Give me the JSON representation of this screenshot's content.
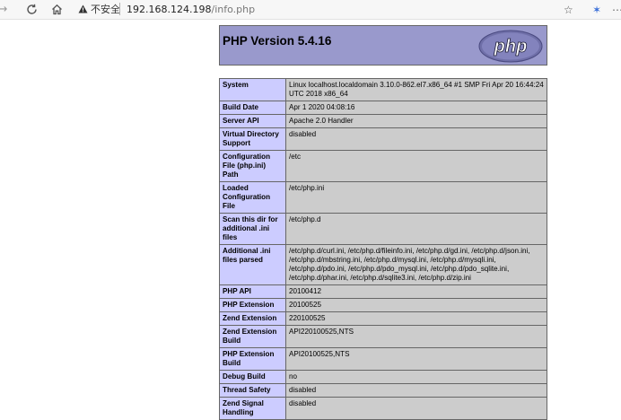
{
  "browser": {
    "back_icon": "back-arrow-icon",
    "reload_icon": "reload-icon",
    "home_icon": "home-icon",
    "security_label": "不安全",
    "url_host": "192.168.124.198",
    "url_path": "/info.php"
  },
  "phpinfo": {
    "title": "PHP Version 5.4.16",
    "logo_text": "php",
    "rows": [
      {
        "key": "System",
        "value": "Linux localhost.localdomain 3.10.0-862.el7.x86_64 #1 SMP Fri Apr 20 16:44:24 UTC 2018 x86_64"
      },
      {
        "key": "Build Date",
        "value": "Apr 1 2020 04:08:16"
      },
      {
        "key": "Server API",
        "value": "Apache 2.0 Handler"
      },
      {
        "key": "Virtual Directory Support",
        "value": "disabled"
      },
      {
        "key": "Configuration File (php.ini) Path",
        "value": "/etc"
      },
      {
        "key": "Loaded Configuration File",
        "value": "/etc/php.ini"
      },
      {
        "key": "Scan this dir for additional .ini files",
        "value": "/etc/php.d"
      },
      {
        "key": "Additional .ini files parsed",
        "value": "/etc/php.d/curl.ini, /etc/php.d/fileinfo.ini, /etc/php.d/gd.ini, /etc/php.d/json.ini, /etc/php.d/mbstring.ini, /etc/php.d/mysql.ini, /etc/php.d/mysqli.ini, /etc/php.d/pdo.ini, /etc/php.d/pdo_mysql.ini, /etc/php.d/pdo_sqlite.ini, /etc/php.d/phar.ini, /etc/php.d/sqlite3.ini, /etc/php.d/zip.ini"
      },
      {
        "key": "PHP API",
        "value": "20100412"
      },
      {
        "key": "PHP Extension",
        "value": "20100525"
      },
      {
        "key": "Zend Extension",
        "value": "220100525"
      },
      {
        "key": "Zend Extension Build",
        "value": "API220100525,NTS"
      },
      {
        "key": "PHP Extension Build",
        "value": "API20100525,NTS"
      },
      {
        "key": "Debug Build",
        "value": "no"
      },
      {
        "key": "Thread Safety",
        "value": "disabled"
      },
      {
        "key": "Zend Signal Handling",
        "value": "disabled"
      }
    ]
  }
}
